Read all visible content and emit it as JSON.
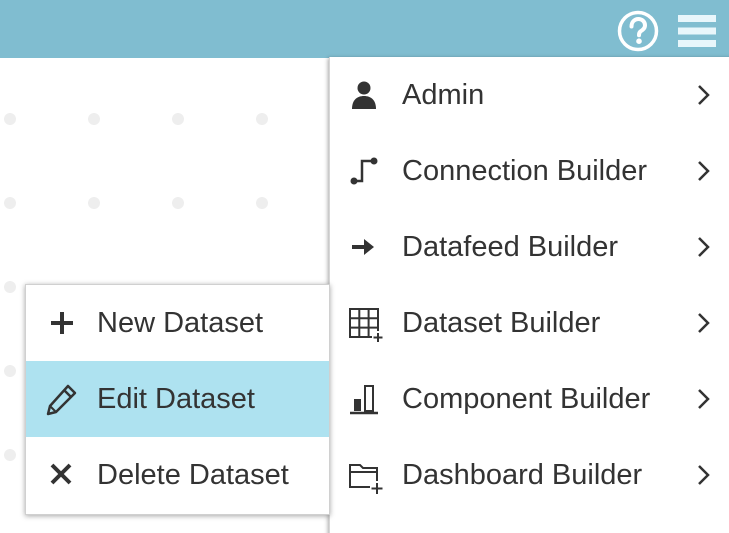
{
  "colors": {
    "topbar": "#80bdd0",
    "active_item": "#aee2f0",
    "text": "#333333",
    "icon_light": "#e8f6fb"
  },
  "topbar": {
    "help_icon": "help-circle-icon",
    "menu_icon": "hamburger-menu-icon"
  },
  "main_menu": {
    "items": [
      {
        "label": "Admin",
        "icon": "user-icon"
      },
      {
        "label": "Connection Builder",
        "icon": "connection-icon"
      },
      {
        "label": "Datafeed Builder",
        "icon": "arrow-right-icon"
      },
      {
        "label": "Dataset Builder",
        "icon": "table-plus-icon"
      },
      {
        "label": "Component Builder",
        "icon": "bar-chart-icon"
      },
      {
        "label": "Dashboard Builder",
        "icon": "folder-plus-icon"
      }
    ]
  },
  "submenu": {
    "items": [
      {
        "label": "New Dataset",
        "icon": "plus-icon"
      },
      {
        "label": "Edit Dataset",
        "icon": "pencil-icon",
        "highlighted": true
      },
      {
        "label": "Delete Dataset",
        "icon": "close-icon"
      }
    ]
  }
}
